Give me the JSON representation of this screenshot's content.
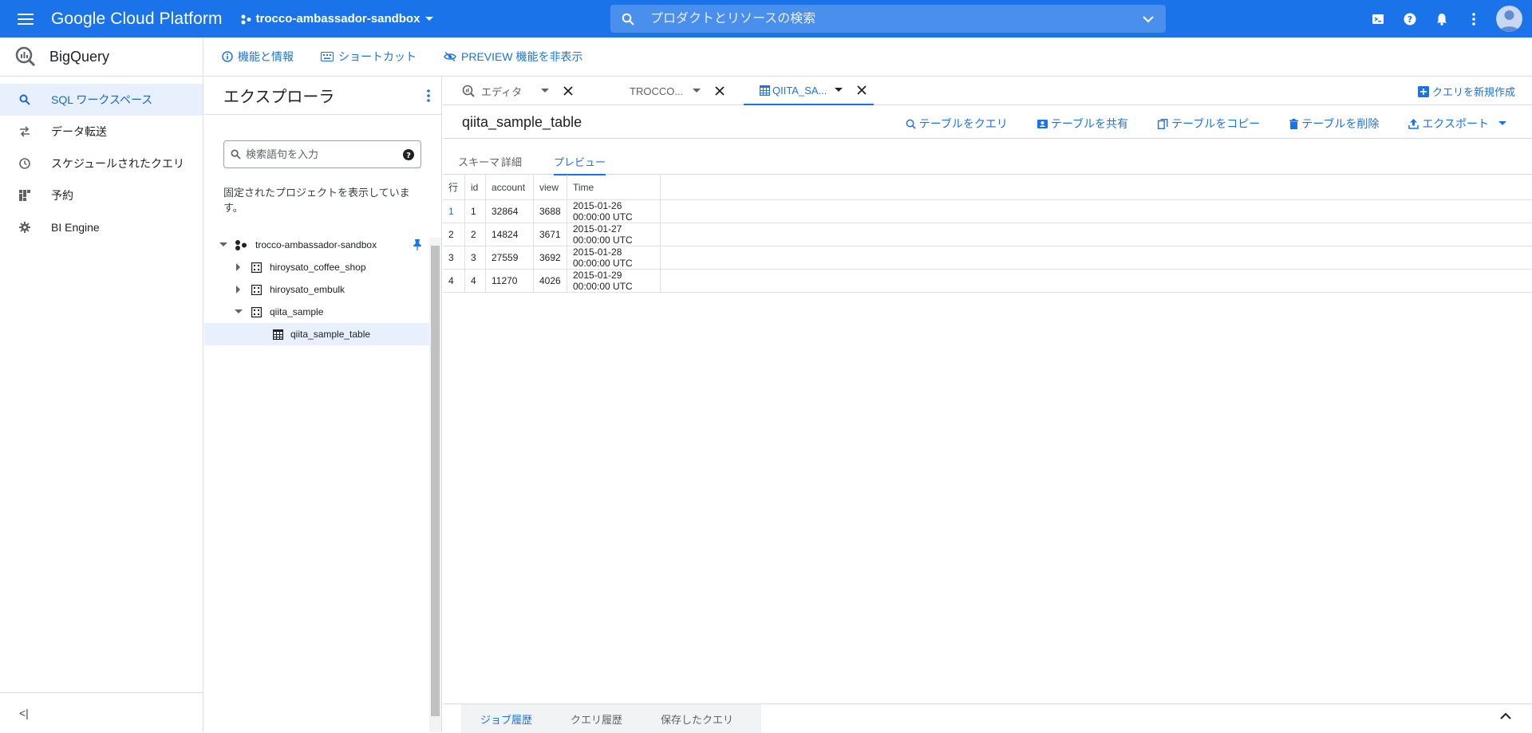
{
  "topbar": {
    "brand": "Google Cloud Platform",
    "project": "trocco-ambassador-sandbox",
    "search_placeholder": "プロダクトとリソースの検索"
  },
  "product": {
    "name": "BigQuery"
  },
  "leftnav": {
    "items": [
      {
        "label": "SQL ワークスペース",
        "icon": "search-icon"
      },
      {
        "label": "データ転送",
        "icon": "transfer-icon"
      },
      {
        "label": "スケジュールされたクエリ",
        "icon": "clock-icon"
      },
      {
        "label": "予約",
        "icon": "reservation-icon"
      },
      {
        "label": "BI Engine",
        "icon": "gear-icon"
      }
    ],
    "collapse_label": "<|"
  },
  "actionbar": {
    "features": "機能と情報",
    "shortcuts": "ショートカット",
    "hide_preview": "PREVIEW 機能を非表示"
  },
  "explorer": {
    "title": "エクスプローラ",
    "search_placeholder": "検索語句を入力",
    "pinned_message": "固定されたプロジェクトを表示しています。",
    "project": "trocco-ambassador-sandbox",
    "datasets": [
      "hiroysato_coffee_shop",
      "hiroysato_embulk",
      "qiita_sample"
    ],
    "table": "qiita_sample_table"
  },
  "tabs": {
    "editor": "エディタ",
    "trocco": "TROCCO...",
    "qiita": "QIITA_SA...",
    "new_query": "クエリを新規作成"
  },
  "table_view": {
    "name": "qiita_sample_table",
    "actions": [
      "テーブルをクエリ",
      "テーブルを共有",
      "テーブルをコピー",
      "テーブルを削除",
      "エクスポート"
    ],
    "subtabs": [
      "スキーマ",
      "詳細",
      "プレビュー"
    ]
  },
  "preview": {
    "columns": [
      "行",
      "id",
      "account",
      "view",
      "Time"
    ],
    "rows": [
      [
        "1",
        "1",
        "32864",
        "3688",
        "2015-01-26 00:00:00 UTC"
      ],
      [
        "2",
        "2",
        "14824",
        "3671",
        "2015-01-27 00:00:00 UTC"
      ],
      [
        "3",
        "3",
        "27559",
        "3692",
        "2015-01-28 00:00:00 UTC"
      ],
      [
        "4",
        "4",
        "11270",
        "4026",
        "2015-01-29 00:00:00 UTC"
      ]
    ]
  },
  "bottom": {
    "tabs": [
      "ジョブ履歴",
      "クエリ履歴",
      "保存したクエリ"
    ]
  }
}
